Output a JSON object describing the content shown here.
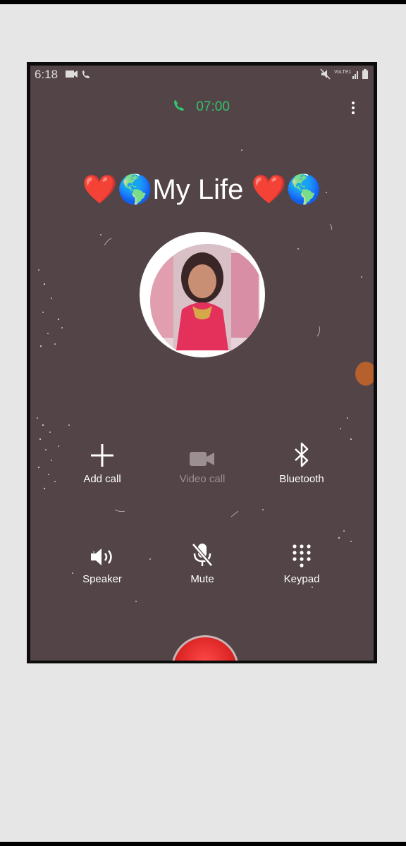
{
  "status_bar": {
    "time": "6:18",
    "left_icons": [
      "video-record-icon",
      "phone-icon"
    ],
    "right_icons": [
      "mute-icon",
      "volte-icon",
      "signal-icon",
      "battery-icon"
    ],
    "volte_text": "VoLTE1"
  },
  "call": {
    "timer": "07:00",
    "caller_name": "❤️🌎My Life ❤️🌎"
  },
  "controls": [
    {
      "label": "Add call",
      "icon": "plus-icon",
      "enabled": true
    },
    {
      "label": "Video call",
      "icon": "video-camera-icon",
      "enabled": false
    },
    {
      "label": "Bluetooth",
      "icon": "bluetooth-icon",
      "enabled": true
    },
    {
      "label": "Speaker",
      "icon": "speaker-icon",
      "enabled": true
    },
    {
      "label": "Mute",
      "icon": "microphone-off-icon",
      "enabled": true
    },
    {
      "label": "Keypad",
      "icon": "keypad-icon",
      "enabled": true
    }
  ],
  "colors": {
    "screen_bg": "#534447",
    "timer_green": "#32c36c",
    "end_call_red": "#e52424",
    "page_bg": "#e6e6e6"
  }
}
